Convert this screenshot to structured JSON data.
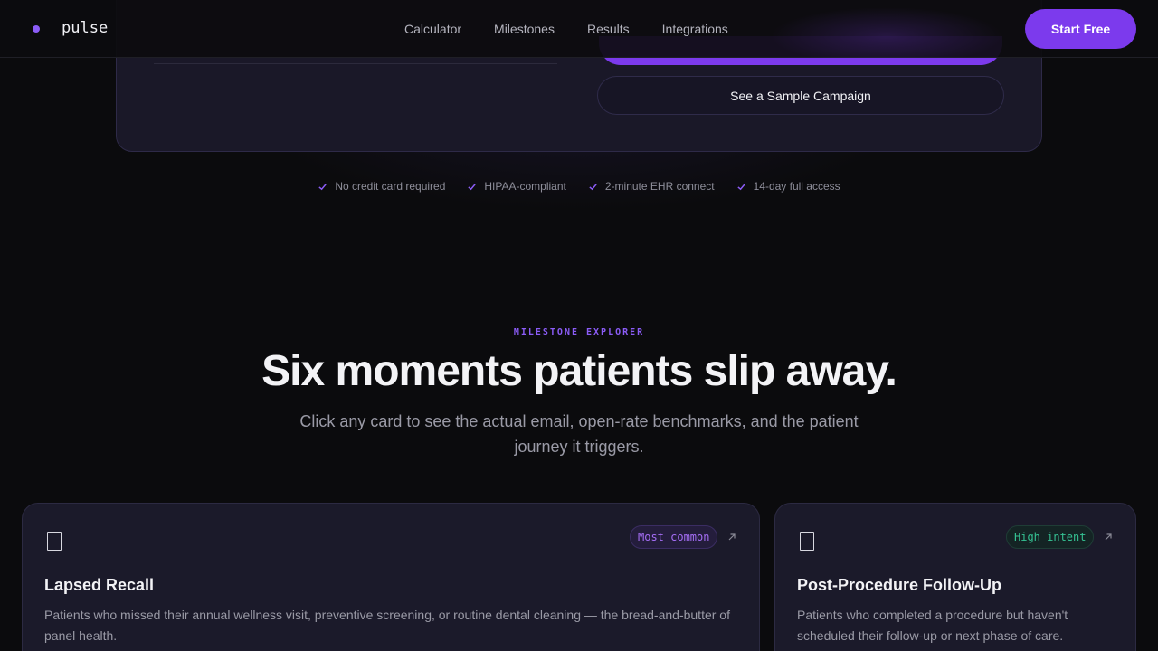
{
  "nav": {
    "brand": "pulse",
    "links": [
      "Calculator",
      "Milestones",
      "Results",
      "Integrations"
    ],
    "cta": "Start Free"
  },
  "calculator_card": {
    "secondary_button": "See a Sample Campaign"
  },
  "trust_items": [
    "No credit card required",
    "HIPAA-compliant",
    "2-minute EHR connect",
    "14-day full access"
  ],
  "milestones": {
    "eyebrow": "MILESTONE EXPLORER",
    "headline": "Six moments patients slip away.",
    "subhead": "Click any card to see the actual email, open-rate benchmarks, and the patient journey it triggers.",
    "cards": [
      {
        "icon": "document-icon",
        "badge": "Most common",
        "badge_color": "#a56ef5",
        "title": "Lapsed Recall",
        "description": "Patients who missed their annual wellness visit, preventive screening, or routine dental cleaning — the bread-and-butter of panel health."
      },
      {
        "icon": "document-icon",
        "badge": "High intent",
        "badge_color": "#35c293",
        "title": "Post-Procedure Follow-Up",
        "description": "Patients who completed a procedure but haven't scheduled their follow-up or next phase of care."
      }
    ]
  },
  "colors": {
    "accent": "#7c3aed",
    "background": "#0b0b0d",
    "card": "#1b1a2a"
  }
}
